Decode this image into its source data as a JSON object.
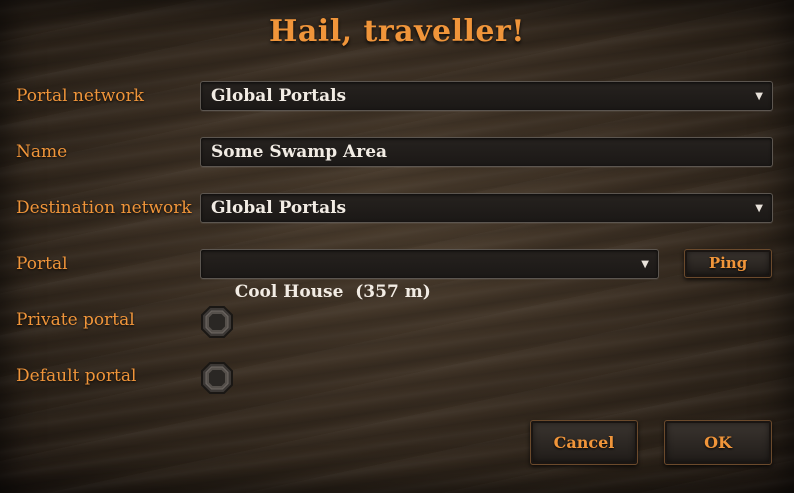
{
  "dialog": {
    "title": "Hail, traveller!"
  },
  "form": {
    "portal_network": {
      "label": "Portal network",
      "value": "Global Portals"
    },
    "name": {
      "label": "Name",
      "value": "Some Swamp Area"
    },
    "destination_network": {
      "label": "Destination network",
      "value": "Global Portals"
    },
    "portal": {
      "label": "Portal",
      "value": "Cool House  (357 m)",
      "ping_label": "Ping"
    },
    "private_portal": {
      "label": "Private portal",
      "checked": false
    },
    "default_portal": {
      "label": "Default portal",
      "checked": false
    }
  },
  "buttons": {
    "cancel": "Cancel",
    "ok": "OK"
  },
  "icons": {
    "dropdown": "chevron-down-icon",
    "checkbox": "octagon-checkbox-icon"
  },
  "colors": {
    "accent": "#f0953a",
    "field_text": "#f2ece4",
    "field_bg": "#1f1b18",
    "wood": "#3a2e22"
  }
}
